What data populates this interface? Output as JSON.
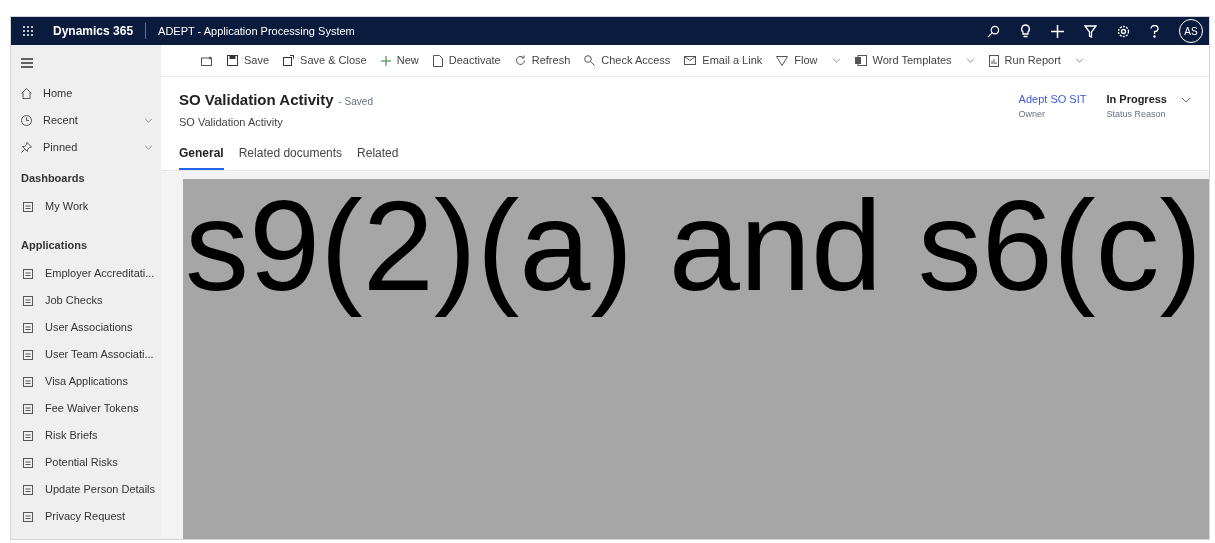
{
  "top_bar": {
    "app_name": "Dynamics 365",
    "title": "ADEPT - Application Processing System",
    "avatar": "AS"
  },
  "command_bar": [
    {
      "kind": "icon"
    },
    {
      "label": "Save",
      "dropdown": false
    },
    {
      "label": "Save & Close",
      "dropdown": false
    },
    {
      "label": "New",
      "dropdown": false
    },
    {
      "label": "Deactivate",
      "dropdown": false
    },
    {
      "label": "Refresh",
      "dropdown": false
    },
    {
      "label": "Check Access",
      "dropdown": false
    },
    {
      "label": "Email a Link",
      "dropdown": false
    },
    {
      "label": "Flow",
      "dropdown": true
    },
    {
      "label": "Word Templates",
      "dropdown": true
    },
    {
      "label": "Run Report",
      "dropdown": true
    }
  ],
  "sidebar": {
    "top_items": [
      {
        "label": "Home",
        "expandable": false
      },
      {
        "label": "Recent",
        "expandable": true
      },
      {
        "label": "Pinned",
        "expandable": true
      }
    ],
    "sections": [
      {
        "title": "Dashboards",
        "items": [
          "My Work"
        ]
      },
      {
        "title": "Applications",
        "items": [
          "Employer Accreditati...",
          "Job Checks",
          "User Associations",
          "User Team Associati...",
          "Visa Applications",
          "Fee Waiver Tokens",
          "Risk Briefs",
          "Potential Risks",
          "Update Person Details",
          "Privacy Request"
        ]
      }
    ]
  },
  "record": {
    "title": "SO Validation Activity",
    "save_state": "- Saved",
    "entity": "SO Validation Activity",
    "header_fields": [
      {
        "value": "Adept SO SIT",
        "label": "Owner",
        "link": true
      },
      {
        "value": "In Progress",
        "label": "Status Reason",
        "link": false
      }
    ]
  },
  "tabs": [
    {
      "label": "General",
      "selected": true
    },
    {
      "label": "Related documents",
      "selected": false
    },
    {
      "label": "Related",
      "selected": false
    }
  ],
  "redaction": {
    "text": "s9(2)(a) and s6(c)"
  }
}
